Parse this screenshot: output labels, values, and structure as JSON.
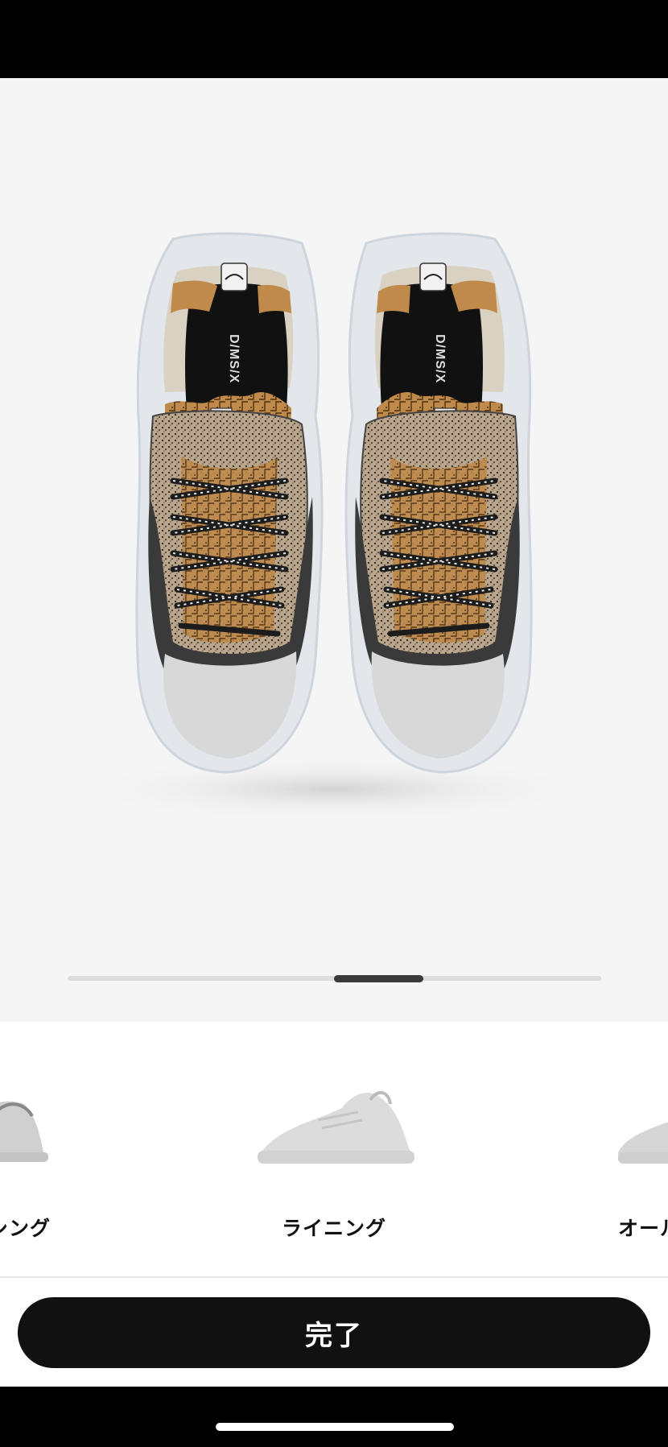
{
  "product_view": {
    "brand_text_left": "D/MS/X",
    "brand_text_right": "D/MS/X"
  },
  "carousel": {
    "items": [
      {
        "label": "フォクシング"
      },
      {
        "label": "ライニング"
      },
      {
        "label": "オール"
      }
    ],
    "scroll_position": 0.52
  },
  "footer": {
    "done_label": "完了"
  },
  "colors": {
    "background": "#f5f5f5",
    "button": "#111111",
    "accent_tan": "#c08a4a"
  }
}
